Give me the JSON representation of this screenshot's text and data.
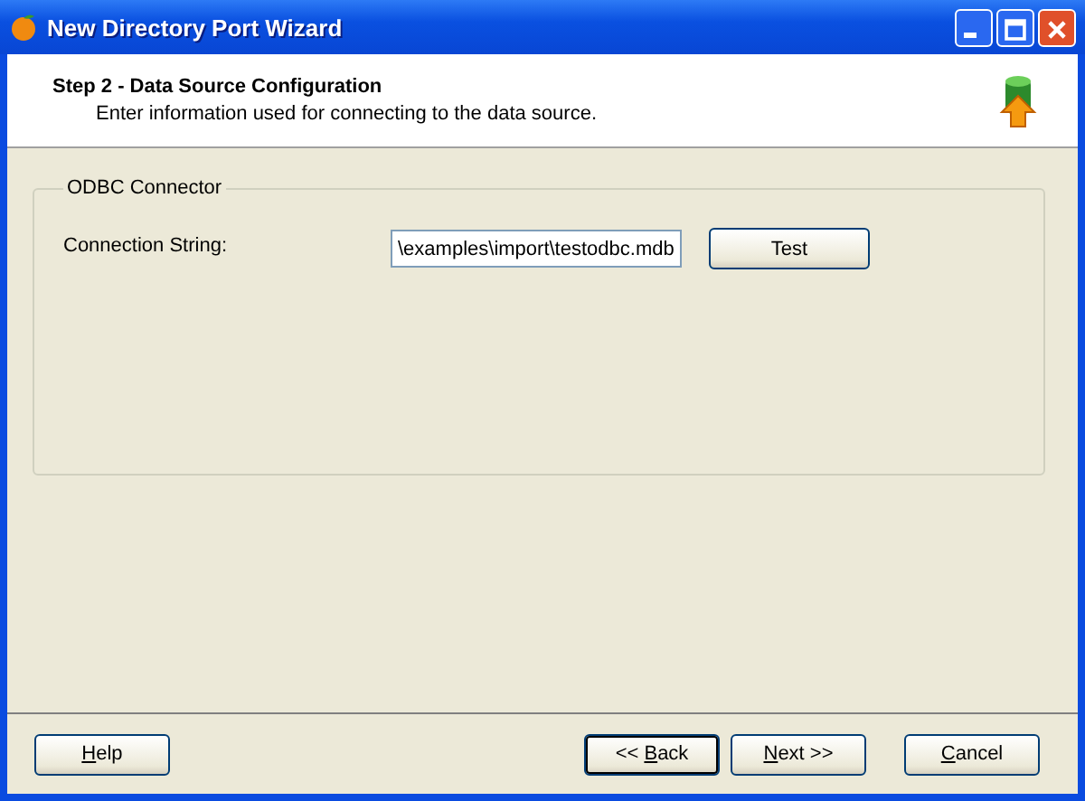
{
  "window": {
    "title": "New Directory Port Wizard"
  },
  "header": {
    "title": "Step 2 - Data Source Configuration",
    "subtitle": "Enter information used for connecting to the data source."
  },
  "group": {
    "legend": "ODBC Connector",
    "label": "Connection String:",
    "value": "\\examples\\import\\testodbc.mdb",
    "button": "Test"
  },
  "buttons": [
    {
      "access_key": "H",
      "after_key": "elp",
      "default": false
    },
    {
      "before_key": "<< ",
      "access_key": "B",
      "after_key": "ack",
      "default": true
    },
    {
      "access_key": "N",
      "after_key": "ext >>",
      "default": false
    },
    {
      "access_key": "C",
      "after_key": "ancel",
      "default": false
    }
  ]
}
